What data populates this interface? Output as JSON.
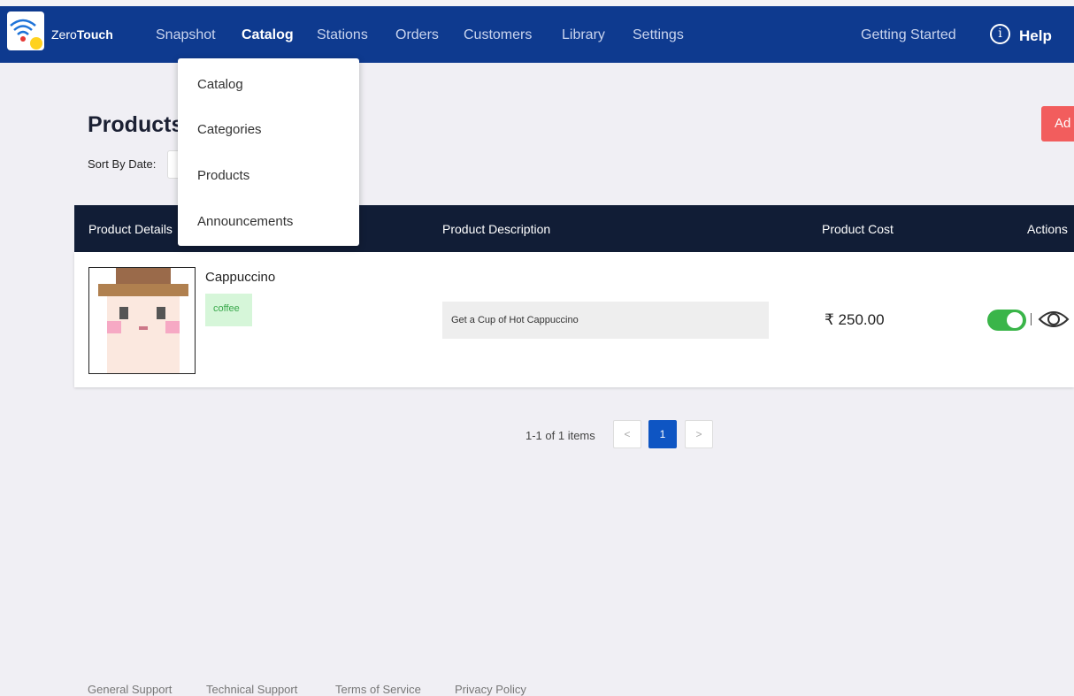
{
  "brand": {
    "prefix": "Zero",
    "bold": "Touch"
  },
  "nav": {
    "items": [
      {
        "label": "Snapshot"
      },
      {
        "label": "Catalog"
      },
      {
        "label": "Stations"
      },
      {
        "label": "Orders"
      },
      {
        "label": "Customers"
      },
      {
        "label": "Library"
      },
      {
        "label": "Settings"
      }
    ],
    "getting_started": "Getting Started",
    "help_icon_glyph": "i",
    "help_label": "Help"
  },
  "catalog_dropdown": {
    "items": [
      "Catalog",
      "Categories",
      "Products",
      "Announcements"
    ]
  },
  "page": {
    "title": "Products",
    "sort_label": "Sort By Date:",
    "add_button": "Ad"
  },
  "table": {
    "headers": [
      "Product Details",
      "Product Description",
      "Product Cost",
      "Actions"
    ],
    "rows": [
      {
        "name": "Cappuccino",
        "tag": "coffee",
        "description": "Get a Cup of Hot Cappuccino",
        "cost": "₹ 250.00",
        "active": true
      }
    ]
  },
  "pagination": {
    "summary": "1-1 of 1 items",
    "prev": "<",
    "current": "1",
    "next": ">"
  },
  "footer": {
    "links": [
      "General Support",
      "Technical Support",
      "Terms of Service",
      "Privacy Policy"
    ]
  },
  "colors": {
    "navbar": "#0e3a8f",
    "table_header": "#111d36",
    "add_button": "#f25d5d",
    "toggle_on": "#3ab549",
    "tag_bg": "#d6f6d9",
    "page_active": "#0e55c3"
  }
}
